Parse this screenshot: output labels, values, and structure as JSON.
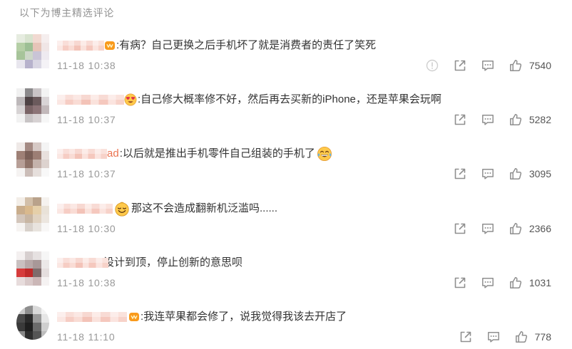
{
  "header": {
    "title": "以下为博主精选评论"
  },
  "colors": {
    "text": "#333333",
    "meta": "#999999",
    "username": "#eb7350",
    "icon": "#8f8f8f",
    "report_icon": "#cfcfcf",
    "username_blur": "#f5c9bf"
  },
  "comments": [
    {
      "badge_icon": "vip-badge-icon",
      "text": ":有病？自己更换之后手机坏了就是消费者的责任了笑死",
      "time": "11-18 10:38",
      "likes": "7540",
      "actions": [
        "report-icon",
        "share-icon",
        "comment-icon",
        "like-icon"
      ],
      "avatar_colors": [
        "#e6ece0",
        "#d8e3cf",
        "#f1d9d1",
        "#f5eeee",
        "#b5cfa6",
        "#9dbf95",
        "#e6c4b8",
        "#f0e6e6",
        "#a7c49a",
        "#cdd7c8",
        "#c9c4d6",
        "#eeeaf0",
        "#e8e6ee",
        "#b7b2cc",
        "#d9d6e3",
        "#f4f2f6"
      ]
    },
    {
      "badge_icon": "heart-eyes-emoji-icon",
      "text": ":自己修大概率修不好，然后再去买新的iPhone，还是苹果会玩啊",
      "time": "11-18 10:37",
      "likes": "5282",
      "actions": [
        "share-icon",
        "comment-icon",
        "like-icon"
      ],
      "avatar_colors": [
        "#f1f1f1",
        "#8c8a8c",
        "#c9c4c6",
        "#f3f3f3",
        "#bdb8ba",
        "#4e4244",
        "#6b5a5c",
        "#d9d4d6",
        "#d7d3d4",
        "#7a6466",
        "#8c7477",
        "#c2b8ba",
        "#f2f2f2",
        "#c8c4c5",
        "#d7d2d3",
        "#f6f6f6"
      ]
    },
    {
      "name_suffix": "ad",
      "text": ":以后就是推出手机零件自己组装的手机了",
      "trailing_icon": "laughing-tears-emoji-icon",
      "time": "11-18 10:37",
      "likes": "3095",
      "actions": [
        "share-icon",
        "comment-icon",
        "like-icon"
      ],
      "avatar_colors": [
        "#efe9e7",
        "#a48a83",
        "#d6c9c5",
        "#f4f4f4",
        "#9e8076",
        "#7a5f57",
        "#9c7e74",
        "#e8e0dd",
        "#b79f97",
        "#8f7369",
        "#c4b2ab",
        "#ddd3cf",
        "#f5f3f2",
        "#cbbdb8",
        "#e6dfdc",
        "#f8f8f8"
      ]
    },
    {
      "badge_icon": "grin-emoji-icon",
      "text": "那这不会造成翻新机泛滥吗......",
      "time": "11-18 10:30",
      "likes": "2366",
      "actions": [
        "share-icon",
        "comment-icon",
        "like-icon"
      ],
      "avatar_colors": [
        "#f3eee8",
        "#d2bfa9",
        "#b9a28b",
        "#f5f2ef",
        "#c9ad8c",
        "#d9b98d",
        "#e5cfa9",
        "#e9e2d8",
        "#d3c6bb",
        "#c8b6a3",
        "#e0d2c0",
        "#ece6df",
        "#f6f4f2",
        "#d8d1cb",
        "#e8e3de",
        "#f8f7f6"
      ]
    },
    {
      "text": "设计到顶，停止创新的意思呗",
      "time": "11-18 10:38",
      "likes": "1031",
      "actions": [
        "share-icon",
        "comment-icon",
        "like-icon"
      ],
      "avatar_colors": [
        "#f4f0f0",
        "#d7cfcf",
        "#e6e1e1",
        "#f6f6f6",
        "#c9c0c0",
        "#b7a8a8",
        "#a89898",
        "#ece8e8",
        "#d63b3b",
        "#c02a2a",
        "#7e6c6c",
        "#e5dede",
        "#e7dcdc",
        "#d9c9c9",
        "#cbb7b7",
        "#f5f2f2"
      ]
    },
    {
      "badge_icon": "vip-badge-icon",
      "text": ":我连苹果都会修了，说我觉得我该去开店了",
      "time": "11-18 11:10",
      "likes": "778",
      "actions": [
        "share-icon",
        "comment-icon",
        "like-icon"
      ],
      "avatar_colors": [
        "#c9c9c9",
        "#8e8e8e",
        "#d9d9d9",
        "#f3f3f3",
        "#4a4a4a",
        "#2b2b2b",
        "#9a9a9a",
        "#e6e6e6",
        "#3a3a3a",
        "#1f1f1f",
        "#6b6b6b",
        "#cfcfcf",
        "#8a8a8a",
        "#2e2e2e",
        "#555555",
        "#bdbdbd"
      ]
    }
  ]
}
